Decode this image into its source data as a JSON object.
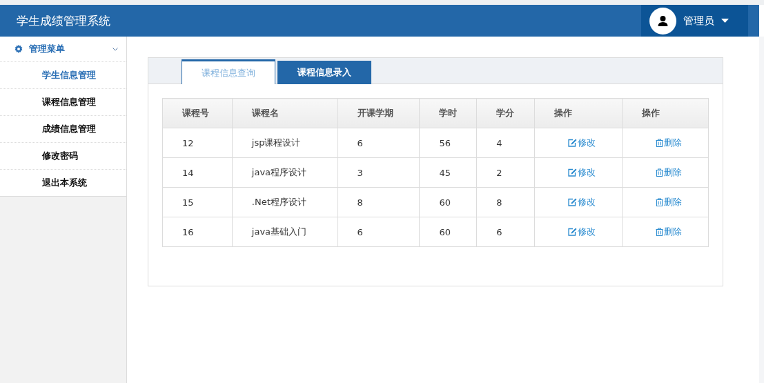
{
  "header": {
    "title": "学生成绩管理系统",
    "user": "管理员"
  },
  "sidebar": {
    "heading": "管理菜单",
    "expanded": true,
    "items": [
      {
        "label": "学生信息管理",
        "selected": true
      },
      {
        "label": "课程信息管理",
        "selected": false
      },
      {
        "label": "成绩信息管理",
        "selected": false
      },
      {
        "label": "修改密码",
        "selected": false
      },
      {
        "label": "退出本系统",
        "selected": false
      }
    ]
  },
  "tabs": [
    {
      "label": "课程信息查询",
      "selected": true
    },
    {
      "label": "课程信息录入",
      "selected": false
    }
  ],
  "table": {
    "columns": [
      "课程号",
      "课程名",
      "开课学期",
      "学时",
      "学分",
      "操作",
      "操作"
    ],
    "rows": [
      {
        "cells": [
          "12",
          "jsp课程设计",
          "6",
          "56",
          "4"
        ],
        "edit": "修改",
        "delete": "删除"
      },
      {
        "cells": [
          "14",
          "java程序设计",
          "3",
          "45",
          "2"
        ],
        "edit": "修改",
        "delete": "删除"
      },
      {
        "cells": [
          "15",
          ".Net程序设计",
          "8",
          "60",
          "8"
        ],
        "edit": "修改",
        "delete": "删除"
      },
      {
        "cells": [
          "16",
          "java基础入门",
          "6",
          "60",
          "6"
        ],
        "edit": "修改",
        "delete": "删除"
      }
    ]
  }
}
